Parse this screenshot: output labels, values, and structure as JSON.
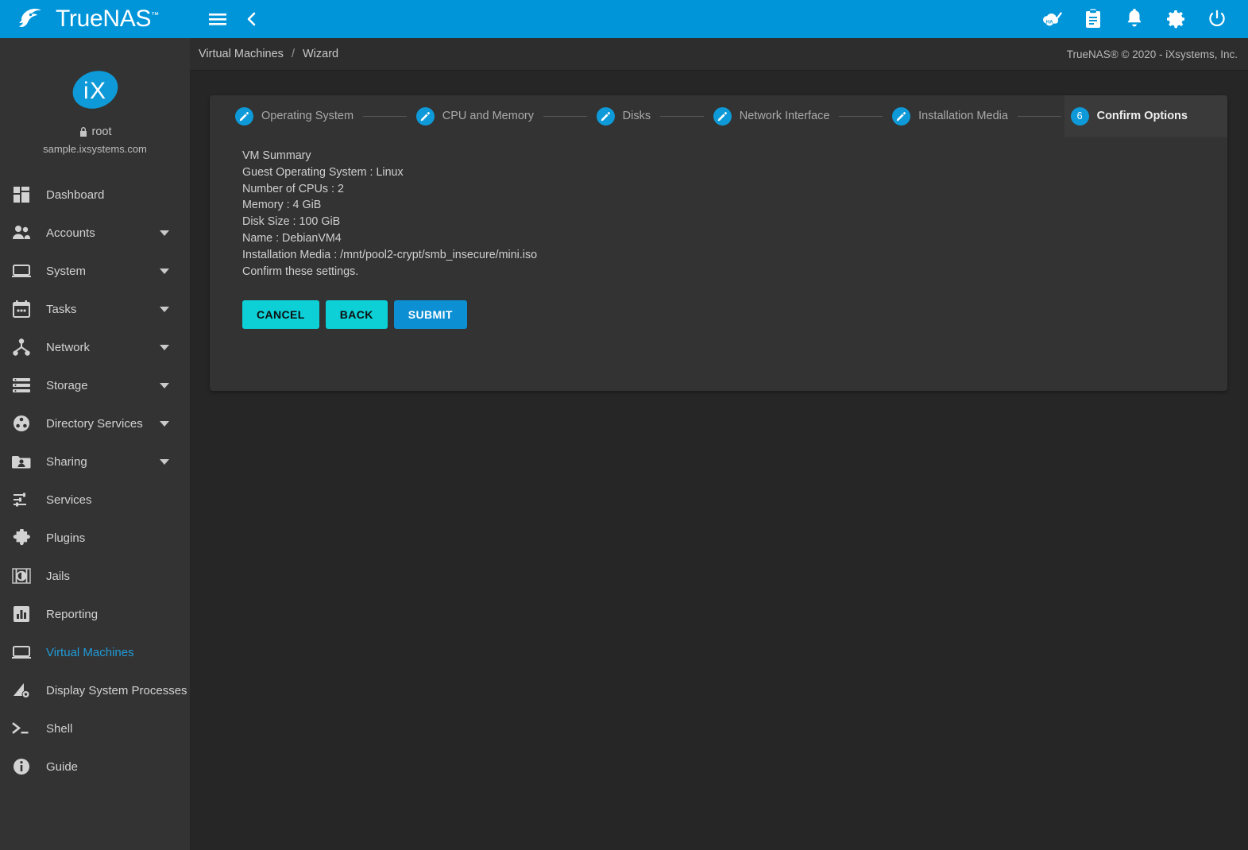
{
  "brand": {
    "name": "TrueNAS",
    "tm": "™",
    "logo_icon": "truenas-wave-logo",
    "header_color": "#0095d9"
  },
  "sidebar": {
    "avatar_icon": "ix-systems-logo",
    "username": "root",
    "lock_icon": "lock-icon",
    "hostname": "sample.ixsystems.com",
    "items": [
      {
        "label": "Dashboard",
        "icon": "dashboard-icon",
        "expandable": false,
        "active": false
      },
      {
        "label": "Accounts",
        "icon": "people-icon",
        "expandable": true,
        "active": false
      },
      {
        "label": "System",
        "icon": "monitor-icon",
        "expandable": true,
        "active": false
      },
      {
        "label": "Tasks",
        "icon": "calendar-icon",
        "expandable": true,
        "active": false
      },
      {
        "label": "Network",
        "icon": "network-tree-icon",
        "expandable": true,
        "active": false
      },
      {
        "label": "Storage",
        "icon": "storage-icon",
        "expandable": true,
        "active": false
      },
      {
        "label": "Directory Services",
        "icon": "directory-circle-icon",
        "expandable": true,
        "active": false
      },
      {
        "label": "Sharing",
        "icon": "folder-shared-icon",
        "expandable": true,
        "active": false
      },
      {
        "label": "Services",
        "icon": "sliders-icon",
        "expandable": false,
        "active": false
      },
      {
        "label": "Plugins",
        "icon": "puzzle-piece-icon",
        "expandable": false,
        "active": false
      },
      {
        "label": "Jails",
        "icon": "jail-box-icon",
        "expandable": false,
        "active": false
      },
      {
        "label": "Reporting",
        "icon": "bar-chart-icon",
        "expandable": false,
        "active": false
      },
      {
        "label": "Virtual Machines",
        "icon": "monitor-icon",
        "expandable": false,
        "active": true
      },
      {
        "label": "Display System Processes",
        "icon": "processes-gear-icon",
        "expandable": false,
        "active": false
      },
      {
        "label": "Shell",
        "icon": "terminal-prompt-icon",
        "expandable": false,
        "active": false
      },
      {
        "label": "Guide",
        "icon": "info-circle-icon",
        "expandable": false,
        "active": false
      }
    ]
  },
  "topbar": {
    "menu_icon": "hamburger-menu-icon",
    "back_icon": "chevron-left-icon",
    "icons": [
      {
        "name": "ha-status-icon",
        "title": "HA"
      },
      {
        "name": "task-manager-icon",
        "title": "Task Manager"
      },
      {
        "name": "notifications-icon",
        "title": "Alerts"
      },
      {
        "name": "settings-gear-icon",
        "title": "Settings"
      },
      {
        "name": "power-icon",
        "title": "Power"
      }
    ]
  },
  "breadcrumb": {
    "parent": "Virtual Machines",
    "separator": "/",
    "current": "Wizard",
    "copyright": "TrueNAS® © 2020 - iXsystems, Inc."
  },
  "wizard": {
    "steps": [
      {
        "label": "Operating System",
        "badge": "edit",
        "number": "1",
        "active": false
      },
      {
        "label": "CPU and Memory",
        "badge": "edit",
        "number": "2",
        "active": false
      },
      {
        "label": "Disks",
        "badge": "edit",
        "number": "3",
        "active": false
      },
      {
        "label": "Network Interface",
        "badge": "edit",
        "number": "4",
        "active": false
      },
      {
        "label": "Installation Media",
        "badge": "edit",
        "number": "5",
        "active": false
      },
      {
        "label": "Confirm Options",
        "badge": "number",
        "number": "6",
        "active": true
      }
    ],
    "summary": [
      "VM Summary",
      "Guest Operating System : Linux",
      "Number of CPUs : 2",
      "Memory : 4 GiB",
      "Disk Size : 100 GiB",
      "Name : DebianVM4",
      "Installation Media : /mnt/pool2-crypt/smb_insecure/mini.iso",
      "Confirm these settings."
    ],
    "buttons": {
      "cancel": "CANCEL",
      "back": "BACK",
      "submit": "SUBMIT"
    }
  },
  "colors": {
    "accent_blue": "#0095d9",
    "step_blue": "#0e9ad8",
    "cyan_button": "#0dcfd6",
    "submit_blue": "#0d8fd3",
    "active_nav": "#1f9bd8",
    "sidebar_bg": "#333333",
    "content_bg": "#262626"
  }
}
